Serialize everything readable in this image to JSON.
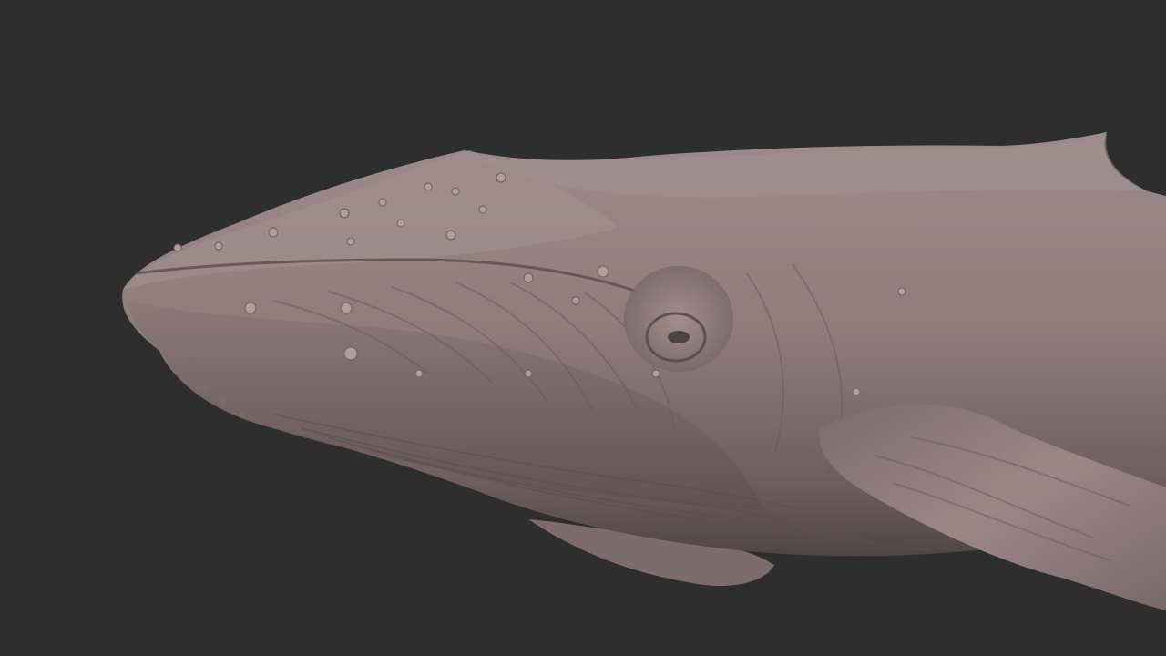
{
  "viewport": {
    "background_color": "#2e2e2e",
    "subject": "humpback-whale-sculpt",
    "material_color": "#8f7d7e"
  }
}
